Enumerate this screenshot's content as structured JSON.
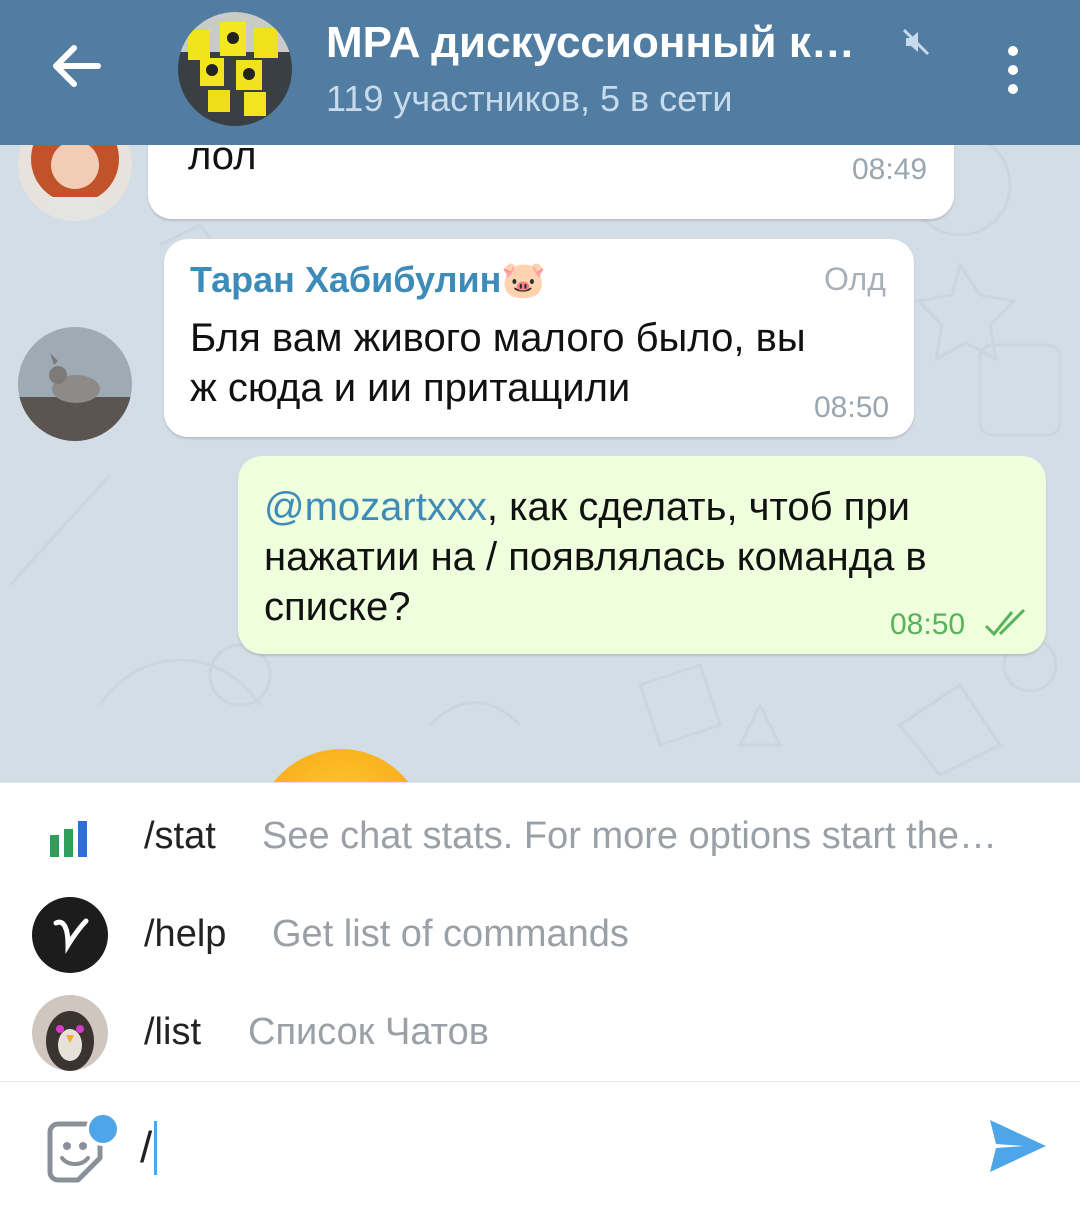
{
  "header": {
    "title": "MPA дискуссионный к…",
    "subtitle": "119 участников, 5 в сети",
    "back_icon": "arrow-left-icon",
    "mute_icon": "muted-icon",
    "menu_icon": "more-vertical-icon"
  },
  "messages": [
    {
      "text": "лол",
      "time": "08:49"
    },
    {
      "sender": "Таран Хабибулин",
      "sender_emoji": "🐷",
      "role": "Олд",
      "text_line1": "Бля вам живого малого было, вы",
      "text_line2": "ж сюда и ии притащили",
      "time": "08:50"
    },
    {
      "mention": "@mozartxxx",
      "text_line1_rest": ", как сделать, чтоб при",
      "text_line2": "нажатии на / появлялась команда в",
      "text_line3": "списке?",
      "time": "08:50",
      "status_icon": "double-check-icon"
    }
  ],
  "commands": [
    {
      "name": "/stat",
      "desc": "See chat stats. For more options start the…",
      "icon": "bar-chart-icon"
    },
    {
      "name": "/help",
      "desc": "Get list of commands",
      "icon": "v-logo-icon"
    },
    {
      "name": "/list",
      "desc": "Список Чатов",
      "icon": "falcon-avatar-icon"
    }
  ],
  "composer": {
    "value": "/",
    "sticker_icon": "sticker-icon",
    "send_icon": "send-icon"
  },
  "colors": {
    "header": "#517da2",
    "chat_bg": "#d3dde6",
    "outgoing_bubble": "#effedd",
    "accent": "#4ea5e7"
  }
}
